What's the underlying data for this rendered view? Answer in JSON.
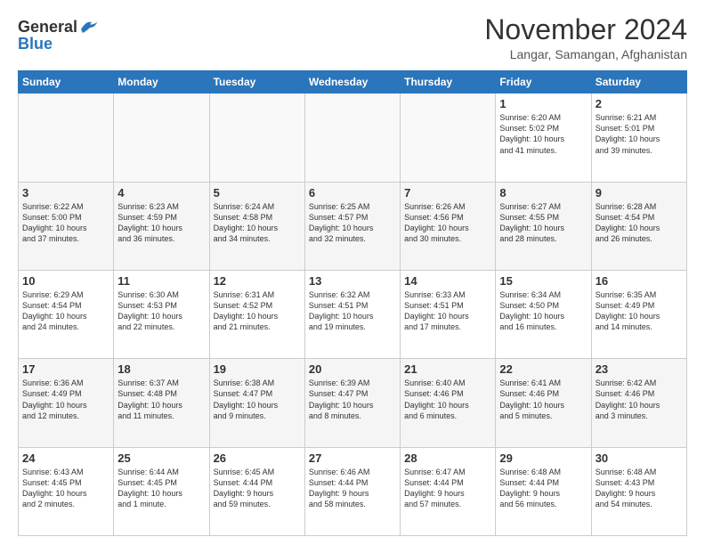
{
  "header": {
    "logo_line1": "General",
    "logo_line2": "Blue",
    "month_title": "November 2024",
    "location": "Langar, Samangan, Afghanistan"
  },
  "days_of_week": [
    "Sunday",
    "Monday",
    "Tuesday",
    "Wednesday",
    "Thursday",
    "Friday",
    "Saturday"
  ],
  "weeks": [
    {
      "shade": "white",
      "days": [
        {
          "num": "",
          "info": "",
          "empty": true
        },
        {
          "num": "",
          "info": "",
          "empty": true
        },
        {
          "num": "",
          "info": "",
          "empty": true
        },
        {
          "num": "",
          "info": "",
          "empty": true
        },
        {
          "num": "",
          "info": "",
          "empty": true
        },
        {
          "num": "1",
          "info": "Sunrise: 6:20 AM\nSunset: 5:02 PM\nDaylight: 10 hours\nand 41 minutes."
        },
        {
          "num": "2",
          "info": "Sunrise: 6:21 AM\nSunset: 5:01 PM\nDaylight: 10 hours\nand 39 minutes."
        }
      ]
    },
    {
      "shade": "gray",
      "days": [
        {
          "num": "3",
          "info": "Sunrise: 6:22 AM\nSunset: 5:00 PM\nDaylight: 10 hours\nand 37 minutes."
        },
        {
          "num": "4",
          "info": "Sunrise: 6:23 AM\nSunset: 4:59 PM\nDaylight: 10 hours\nand 36 minutes."
        },
        {
          "num": "5",
          "info": "Sunrise: 6:24 AM\nSunset: 4:58 PM\nDaylight: 10 hours\nand 34 minutes."
        },
        {
          "num": "6",
          "info": "Sunrise: 6:25 AM\nSunset: 4:57 PM\nDaylight: 10 hours\nand 32 minutes."
        },
        {
          "num": "7",
          "info": "Sunrise: 6:26 AM\nSunset: 4:56 PM\nDaylight: 10 hours\nand 30 minutes."
        },
        {
          "num": "8",
          "info": "Sunrise: 6:27 AM\nSunset: 4:55 PM\nDaylight: 10 hours\nand 28 minutes."
        },
        {
          "num": "9",
          "info": "Sunrise: 6:28 AM\nSunset: 4:54 PM\nDaylight: 10 hours\nand 26 minutes."
        }
      ]
    },
    {
      "shade": "white",
      "days": [
        {
          "num": "10",
          "info": "Sunrise: 6:29 AM\nSunset: 4:54 PM\nDaylight: 10 hours\nand 24 minutes."
        },
        {
          "num": "11",
          "info": "Sunrise: 6:30 AM\nSunset: 4:53 PM\nDaylight: 10 hours\nand 22 minutes."
        },
        {
          "num": "12",
          "info": "Sunrise: 6:31 AM\nSunset: 4:52 PM\nDaylight: 10 hours\nand 21 minutes."
        },
        {
          "num": "13",
          "info": "Sunrise: 6:32 AM\nSunset: 4:51 PM\nDaylight: 10 hours\nand 19 minutes."
        },
        {
          "num": "14",
          "info": "Sunrise: 6:33 AM\nSunset: 4:51 PM\nDaylight: 10 hours\nand 17 minutes."
        },
        {
          "num": "15",
          "info": "Sunrise: 6:34 AM\nSunset: 4:50 PM\nDaylight: 10 hours\nand 16 minutes."
        },
        {
          "num": "16",
          "info": "Sunrise: 6:35 AM\nSunset: 4:49 PM\nDaylight: 10 hours\nand 14 minutes."
        }
      ]
    },
    {
      "shade": "gray",
      "days": [
        {
          "num": "17",
          "info": "Sunrise: 6:36 AM\nSunset: 4:49 PM\nDaylight: 10 hours\nand 12 minutes."
        },
        {
          "num": "18",
          "info": "Sunrise: 6:37 AM\nSunset: 4:48 PM\nDaylight: 10 hours\nand 11 minutes."
        },
        {
          "num": "19",
          "info": "Sunrise: 6:38 AM\nSunset: 4:47 PM\nDaylight: 10 hours\nand 9 minutes."
        },
        {
          "num": "20",
          "info": "Sunrise: 6:39 AM\nSunset: 4:47 PM\nDaylight: 10 hours\nand 8 minutes."
        },
        {
          "num": "21",
          "info": "Sunrise: 6:40 AM\nSunset: 4:46 PM\nDaylight: 10 hours\nand 6 minutes."
        },
        {
          "num": "22",
          "info": "Sunrise: 6:41 AM\nSunset: 4:46 PM\nDaylight: 10 hours\nand 5 minutes."
        },
        {
          "num": "23",
          "info": "Sunrise: 6:42 AM\nSunset: 4:46 PM\nDaylight: 10 hours\nand 3 minutes."
        }
      ]
    },
    {
      "shade": "white",
      "days": [
        {
          "num": "24",
          "info": "Sunrise: 6:43 AM\nSunset: 4:45 PM\nDaylight: 10 hours\nand 2 minutes."
        },
        {
          "num": "25",
          "info": "Sunrise: 6:44 AM\nSunset: 4:45 PM\nDaylight: 10 hours\nand 1 minute."
        },
        {
          "num": "26",
          "info": "Sunrise: 6:45 AM\nSunset: 4:44 PM\nDaylight: 9 hours\nand 59 minutes."
        },
        {
          "num": "27",
          "info": "Sunrise: 6:46 AM\nSunset: 4:44 PM\nDaylight: 9 hours\nand 58 minutes."
        },
        {
          "num": "28",
          "info": "Sunrise: 6:47 AM\nSunset: 4:44 PM\nDaylight: 9 hours\nand 57 minutes."
        },
        {
          "num": "29",
          "info": "Sunrise: 6:48 AM\nSunset: 4:44 PM\nDaylight: 9 hours\nand 56 minutes."
        },
        {
          "num": "30",
          "info": "Sunrise: 6:48 AM\nSunset: 4:43 PM\nDaylight: 9 hours\nand 54 minutes."
        }
      ]
    }
  ]
}
